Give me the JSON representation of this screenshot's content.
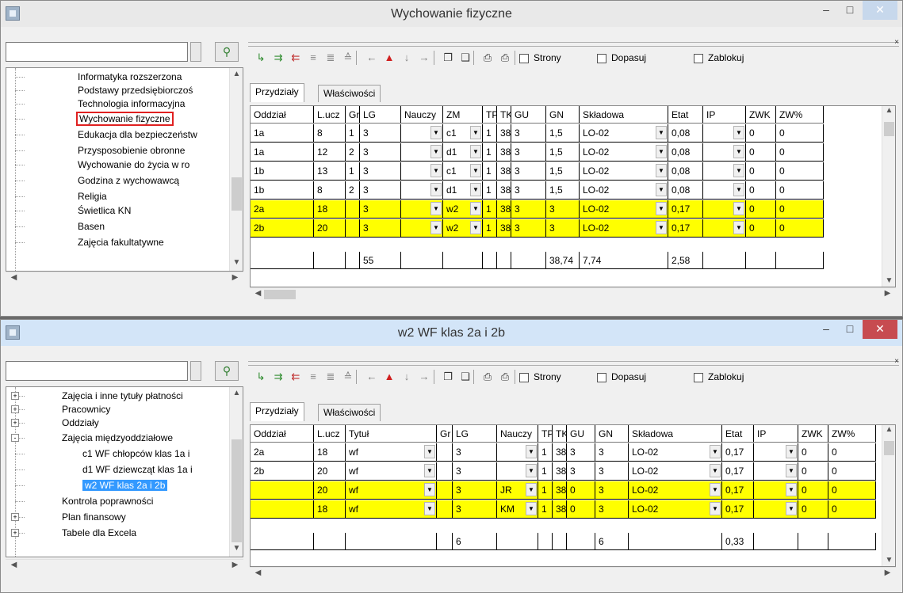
{
  "colors": {
    "highlight_row": "#ffff00",
    "selection": "#3399ff",
    "close_button": "#c74b50"
  },
  "toolbar": {
    "checkboxes": [
      "Strony",
      "Dopasuj",
      "Zablokuj"
    ],
    "icons": [
      "insert-row-icon",
      "insert-rows-icon",
      "remove-row-icon",
      "merge-icon",
      "split-icon",
      "sort-icon",
      "arrow-left-icon",
      "arrow-up-icon",
      "arrow-down-icon",
      "arrow-right-icon",
      "copy-icon",
      "paste-icon",
      "print-preview-icon",
      "print-icon"
    ]
  },
  "tabs": [
    "Przydziały",
    "Właściwości"
  ],
  "window1": {
    "title": "Wychowanie fizyczne",
    "tree": [
      "Informatyka rozszerzona",
      "Podstawy przedsiębiorczoś",
      "Technologia informacyjna",
      "Wychowanie fizyczne",
      "Edukacja dla bezpieczeństw",
      "Przysposobienie obronne",
      "Wychowanie do życia w ro",
      "Godzina z wychowawcą",
      "Religia",
      "Świetlica KN",
      "Basen",
      "Zajęcia fakultatywne"
    ],
    "columns": [
      "Oddział",
      "L.ucz",
      "Gr",
      "LG",
      "Nauczy",
      "ZM",
      "TP",
      "TK",
      "GU",
      "GN",
      "Składowa",
      "Etat",
      "IP",
      "ZWK",
      "ZW%"
    ],
    "rows": [
      [
        "1a",
        "8",
        "1",
        "3",
        "",
        "c1",
        "1",
        "38",
        "3",
        "1,5",
        "LO-02",
        "0,08",
        "",
        "0",
        "0"
      ],
      [
        "1a",
        "12",
        "2",
        "3",
        "",
        "d1",
        "1",
        "38",
        "3",
        "1,5",
        "LO-02",
        "0,08",
        "",
        "0",
        "0"
      ],
      [
        "1b",
        "13",
        "1",
        "3",
        "",
        "c1",
        "1",
        "38",
        "3",
        "1,5",
        "LO-02",
        "0,08",
        "",
        "0",
        "0"
      ],
      [
        "1b",
        "8",
        "2",
        "3",
        "",
        "d1",
        "1",
        "38",
        "3",
        "1,5",
        "LO-02",
        "0,08",
        "",
        "0",
        "0"
      ],
      [
        "2a",
        "18",
        "",
        "3",
        "",
        "w2",
        "1",
        "38",
        "3",
        "3",
        "LO-02",
        "0,17",
        "",
        "0",
        "0"
      ],
      [
        "2b",
        "20",
        "",
        "3",
        "",
        "w2",
        "1",
        "38",
        "3",
        "3",
        "LO-02",
        "0,17",
        "",
        "0",
        "0"
      ]
    ],
    "totals": [
      "",
      "",
      "",
      "55",
      "",
      "",
      "",
      "",
      "",
      "38,74",
      "7,74",
      "2,58",
      "",
      "",
      ""
    ]
  },
  "window2": {
    "title": "w2 WF klas 2a i 2b",
    "tree": [
      "Zajęcia i inne tytuły płatności",
      "Pracownicy",
      "Oddziały",
      "Zajęcia międzyoddziałowe",
      "c1 WF chłopców klas 1a i",
      "d1 WF dziewcząt klas 1a i",
      "w2 WF klas 2a i 2b",
      "Kontrola poprawności",
      "Plan finansowy",
      "Tabele dla Excela"
    ],
    "columns": [
      "Oddział",
      "L.ucz",
      "Tytuł",
      "Gr",
      "LG",
      "Nauczy",
      "TP",
      "TK",
      "GU",
      "GN",
      "Składowa",
      "Etat",
      "IP",
      "ZWK",
      "ZW%"
    ],
    "rows": [
      [
        "2a",
        "18",
        "wf",
        "",
        "3",
        "",
        "1",
        "38",
        "3",
        "3",
        "LO-02",
        "0,17",
        "",
        "0",
        "0"
      ],
      [
        "2b",
        "20",
        "wf",
        "",
        "3",
        "",
        "1",
        "38",
        "3",
        "3",
        "LO-02",
        "0,17",
        "",
        "0",
        "0"
      ],
      [
        "",
        "20",
        "wf",
        "",
        "3",
        "JR",
        "1",
        "38",
        "0",
        "3",
        "LO-02",
        "0,17",
        "",
        "0",
        "0"
      ],
      [
        "",
        "18",
        "wf",
        "",
        "3",
        "KM",
        "1",
        "38",
        "0",
        "3",
        "LO-02",
        "0,17",
        "",
        "0",
        "0"
      ]
    ],
    "totals": [
      "",
      "",
      "",
      "",
      "6",
      "",
      "",
      "",
      "",
      "6",
      "",
      "0,33",
      "",
      "",
      ""
    ]
  }
}
